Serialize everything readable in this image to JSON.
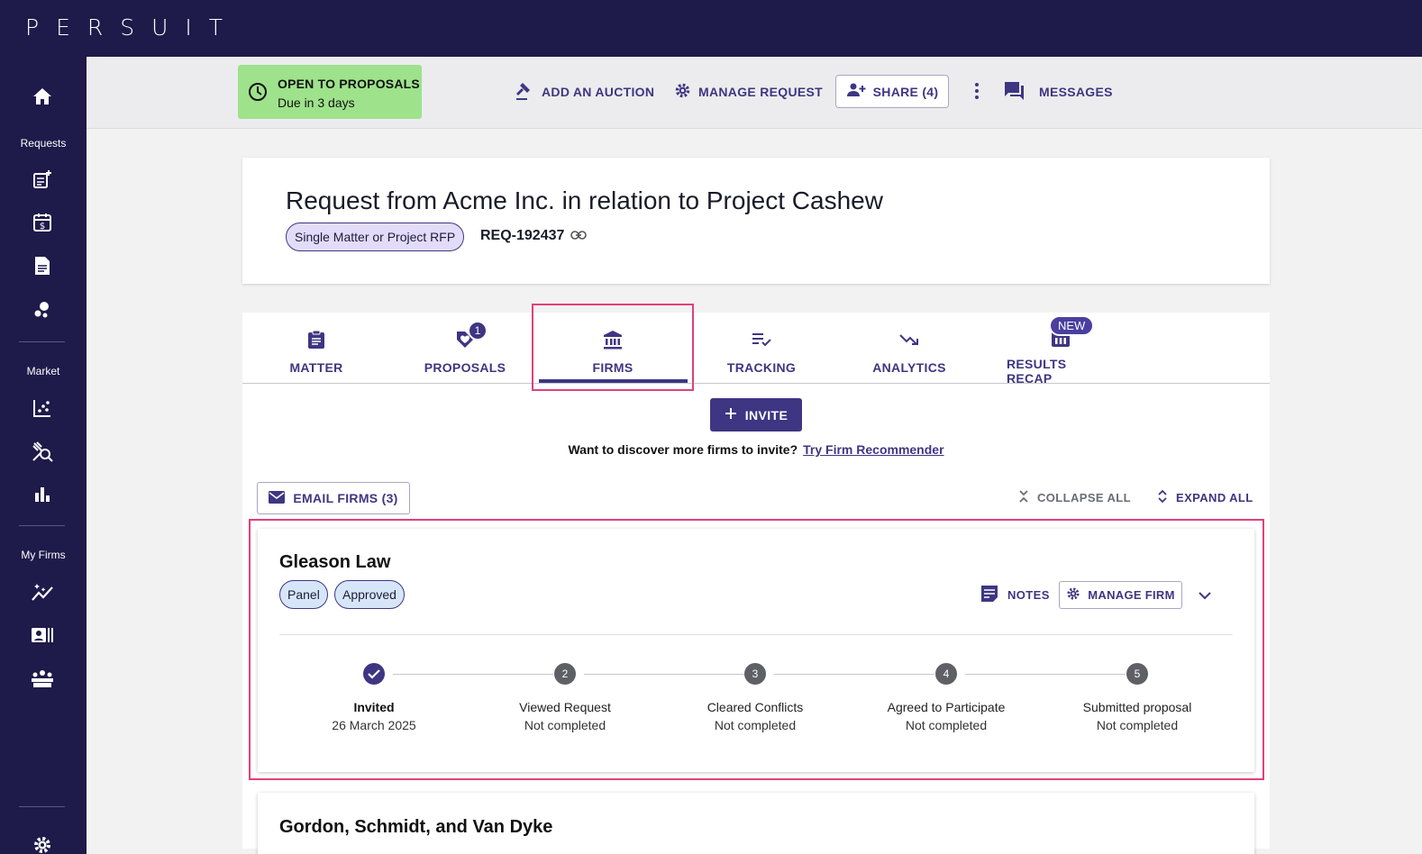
{
  "app": {
    "logo_text": "PERSUIT"
  },
  "sidebar": {
    "sections": {
      "requests": "Requests",
      "market": "Market",
      "my_firms": "My Firms"
    },
    "icons": [
      "home-icon",
      "new-request-icon",
      "invoice-icon",
      "document-icon",
      "bubbles-icon",
      "scatter-chart-icon",
      "search-gavel-icon",
      "bar-chart-icon",
      "sparkle-trend-icon",
      "id-card-icon",
      "team-icon",
      "gear-icon"
    ]
  },
  "status": {
    "title": "OPEN TO PROPOSALS",
    "subtitle": "Due in 3 days",
    "color": "#9ee28c"
  },
  "actions": {
    "add_auction": "ADD AN AUCTION",
    "manage_request": "MANAGE REQUEST",
    "share": "SHARE (4)",
    "messages": "MESSAGES"
  },
  "request": {
    "title": "Request from Acme Inc. in relation to Project Cashew",
    "type": "Single Matter or Project RFP",
    "id": "REQ-192437"
  },
  "tabs": [
    {
      "label": "MATTER",
      "icon": "clipboard-icon"
    },
    {
      "label": "PROPOSALS",
      "icon": "heart-tag-icon",
      "badge": "1"
    },
    {
      "label": "FIRMS",
      "icon": "bank-icon",
      "active": true
    },
    {
      "label": "TRACKING",
      "icon": "list-check-icon"
    },
    {
      "label": "ANALYTICS",
      "icon": "trending-down-icon"
    },
    {
      "label": "RESULTS RECAP",
      "icon": "results-icon",
      "badge": "NEW"
    }
  ],
  "invite": {
    "button": "INVITE",
    "prompt": "Want to discover more firms to invite?",
    "link": "Try Firm Recommender"
  },
  "toolbar": {
    "email_firms": "EMAIL FIRMS (3)",
    "collapse_all": "COLLAPSE ALL",
    "expand_all": "EXPAND ALL"
  },
  "firms": [
    {
      "name": "Gleason Law",
      "tags": [
        "Panel",
        "Approved"
      ],
      "notes": "NOTES",
      "manage": "MANAGE FIRM",
      "steps": [
        {
          "number": "1",
          "title": "Invited",
          "status": "26 March 2025",
          "done": true
        },
        {
          "number": "2",
          "title": "Viewed Request",
          "status": "Not completed"
        },
        {
          "number": "3",
          "title": "Cleared Conflicts",
          "status": "Not completed"
        },
        {
          "number": "4",
          "title": "Agreed to Participate",
          "status": "Not completed"
        },
        {
          "number": "5",
          "title": "Submitted proposal",
          "status": "Not completed"
        }
      ]
    },
    {
      "name": "Gordon, Schmidt, and Van Dyke"
    }
  ]
}
